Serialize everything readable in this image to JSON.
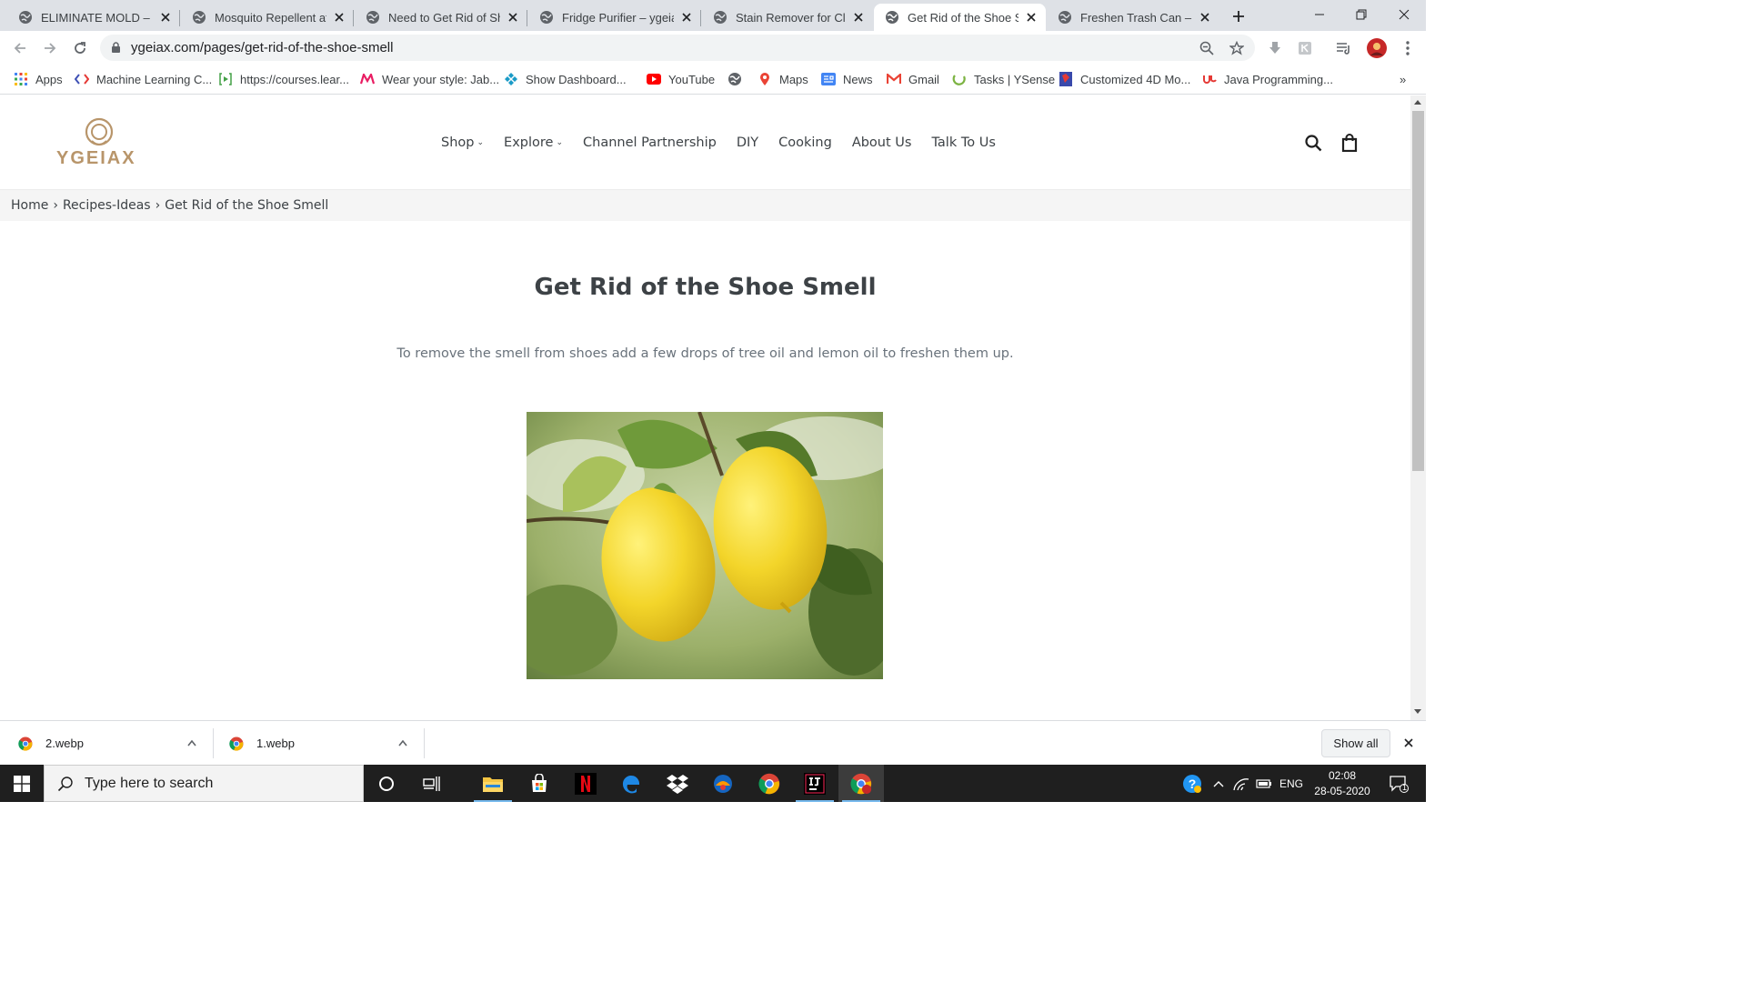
{
  "browser": {
    "tabs": [
      {
        "title": "ELIMINATE MOLD – yg"
      },
      {
        "title": "Mosquito Repellent at"
      },
      {
        "title": "Need to Get Rid of Sho"
      },
      {
        "title": "Fridge Purifier – ygeiax"
      },
      {
        "title": "Stain Remover for Clot"
      },
      {
        "title": "Get Rid of the Shoe Sm"
      },
      {
        "title": "Freshen Trash Can – yg"
      }
    ],
    "url": "ygeiax.com/pages/get-rid-of-the-shoe-smell",
    "bookmarks": [
      {
        "label": "Apps"
      },
      {
        "label": "Machine Learning C..."
      },
      {
        "label": "https://courses.lear..."
      },
      {
        "label": "Wear your style: Jab..."
      },
      {
        "label": "Show Dashboard..."
      },
      {
        "label": "YouTube"
      },
      {
        "label": ""
      },
      {
        "label": "Maps"
      },
      {
        "label": "News"
      },
      {
        "label": "Gmail"
      },
      {
        "label": "Tasks | YSense"
      },
      {
        "label": "Customized 4D Mo..."
      },
      {
        "label": "Java Programming..."
      }
    ],
    "bookmarks_overflow": "»"
  },
  "site": {
    "logo_text": "YGEIAX",
    "nav": [
      {
        "label": "Shop",
        "dropdown": true
      },
      {
        "label": "Explore",
        "dropdown": true
      },
      {
        "label": "Channel Partnership",
        "dropdown": false
      },
      {
        "label": "DIY",
        "dropdown": false
      },
      {
        "label": "Cooking",
        "dropdown": false
      },
      {
        "label": "About Us",
        "dropdown": false
      },
      {
        "label": "Talk To Us",
        "dropdown": false
      }
    ],
    "breadcrumb": {
      "home": "Home",
      "section": "Recipes-Ideas",
      "current": "Get Rid of the Shoe Smell",
      "separator": "›"
    },
    "page_title": "Get Rid of the Shoe Smell",
    "page_body": "To remove the smell from shoes add a few drops of tree oil and lemon oil to freshen them up."
  },
  "downloads": {
    "items": [
      {
        "filename": "2.webp"
      },
      {
        "filename": "1.webp"
      }
    ],
    "show_all": "Show all"
  },
  "taskbar": {
    "search_placeholder": "Type here to search",
    "language": "ENG",
    "time": "02:08",
    "date": "28-05-2020",
    "notification_count": "1"
  },
  "colors": {
    "brand_gold": "#b8956a",
    "text_dark": "#3d4246",
    "text_muted": "#69727b",
    "tabstrip": "#dee1e6"
  }
}
